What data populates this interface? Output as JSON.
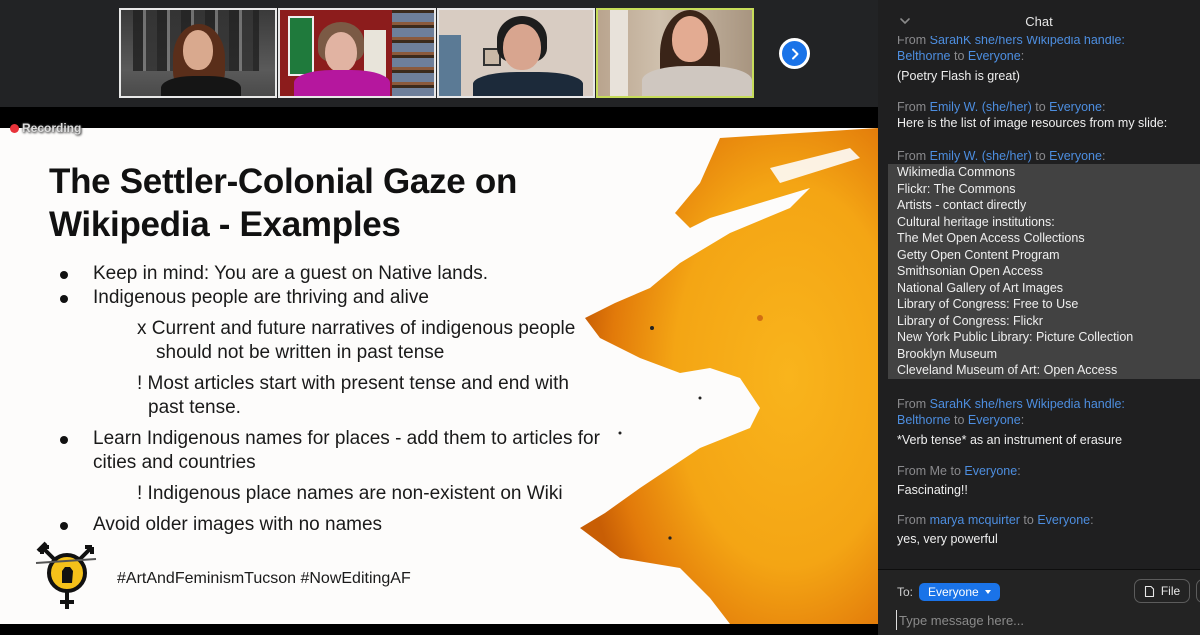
{
  "gallery": {
    "tiles": [
      {
        "name": "participant-1",
        "active": false
      },
      {
        "name": "participant-2",
        "active": false
      },
      {
        "name": "participant-3",
        "active": false
      },
      {
        "name": "participant-4",
        "active": true
      }
    ],
    "next_page_icon": "chevron-right-icon"
  },
  "recording": {
    "label": "Recording",
    "color": "#e8333a"
  },
  "slide": {
    "title_line1": "The Settler-Colonial Gaze on",
    "title_line2": "Wikipedia - Examples",
    "bullets": [
      {
        "text": "Keep in mind: You are a guest on Native lands."
      },
      {
        "text": "Indigenous people are thriving and alive"
      },
      {
        "text": "Learn Indigenous names for places - add them to articles for",
        "text2": "cities and countries"
      },
      {
        "text": "Avoid older images with no names"
      }
    ],
    "subpoints": [
      {
        "text": "x Current and future narratives of indigenous people",
        "text2": "should not be written in past tense"
      },
      {
        "text": "! Most articles start with present tense and end with",
        "text2": "past tense."
      },
      {
        "text": "! Indigenous place names are non-existent on Wiki"
      }
    ],
    "hashtags": "#ArtAndFeminismTucson #NowEditingAF",
    "accent_color": "#f5a312"
  },
  "chat": {
    "title": "Chat",
    "collapse_icon": "chevron-down-icon",
    "messages": [
      {
        "from_prefix": "From ",
        "sender": "SarahK she/hers Wikipedia handle:",
        "sender2": "Belthorne",
        "to_word": " to ",
        "recipient": "Everyone",
        "colon": ":",
        "lines": [
          "(Poetry Flash is great)"
        ]
      },
      {
        "from_prefix": "From ",
        "sender": "Emily W. (she/her)",
        "to_word": " to ",
        "recipient": "Everyone",
        "colon": ":",
        "lines": [
          "Here is the list of image resources from my slide:"
        ]
      },
      {
        "from_prefix": "From ",
        "sender": "Emily W. (she/her)",
        "to_word": " to ",
        "recipient": "Everyone",
        "colon": ":",
        "lines": [
          "Wikimedia Commons",
          "Flickr: The Commons",
          "Artists - contact directly",
          "Cultural heritage institutions:",
          "The Met Open Access Collections",
          "Getty Open Content Program",
          "Smithsonian Open Access",
          "National Gallery of Art Images",
          "Library of Congress: Free to Use",
          "Library of Congress: Flickr",
          "New York Public Library: Picture Collection",
          "Brooklyn Museum",
          "Cleveland Museum of Art: Open Access"
        ]
      },
      {
        "from_prefix": "From ",
        "sender": "SarahK she/hers Wikipedia handle:",
        "sender2": "Belthorne",
        "to_word": " to ",
        "recipient": "Everyone",
        "colon": ":",
        "lines": [
          "*Verb tense* as an instrument of erasure"
        ]
      },
      {
        "from_prefix": "From Me",
        "sender": "",
        "to_word": " to ",
        "recipient": "Everyone",
        "colon": ":",
        "lines": [
          "Fascinating!!"
        ]
      },
      {
        "from_prefix": "From ",
        "sender": "marya mcquirter",
        "to_word": " to ",
        "recipient": "Everyone",
        "colon": ":",
        "lines": [
          "yes, very powerful"
        ]
      }
    ],
    "composer": {
      "to_label": "To:",
      "recipient": "Everyone",
      "file_label": "File",
      "file_icon": "file-icon",
      "placeholder": "Type message here...",
      "value": ""
    },
    "colors": {
      "name_link": "#4d8ee0",
      "recipient_button": "#1a73e8"
    }
  }
}
